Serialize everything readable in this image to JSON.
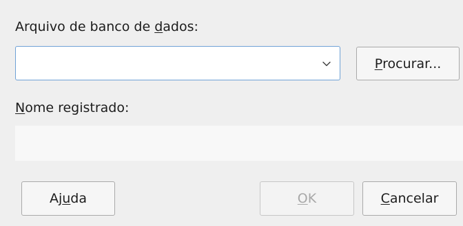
{
  "database_file": {
    "label_prefix": "Arquivo de banco de ",
    "label_mnemonic": "d",
    "label_suffix": "ados:",
    "value": "",
    "dropdown_icon": "chevron-down-icon"
  },
  "browse_button": {
    "label_mnemonic": "P",
    "label_rest": "rocurar..."
  },
  "registered_name": {
    "label_mnemonic": "N",
    "label_rest": "ome registrado:",
    "value": ""
  },
  "buttons": {
    "help": {
      "prefix": "Aj",
      "mnemonic": "u",
      "suffix": "da"
    },
    "ok": {
      "mnemonic": "O",
      "rest": "K",
      "enabled": false
    },
    "cancel": {
      "mnemonic": "C",
      "rest": "ancelar"
    }
  },
  "colors": {
    "background": "#efefef",
    "focus_border": "#6ea1d6",
    "disabled_text": "#a8a8a8"
  }
}
